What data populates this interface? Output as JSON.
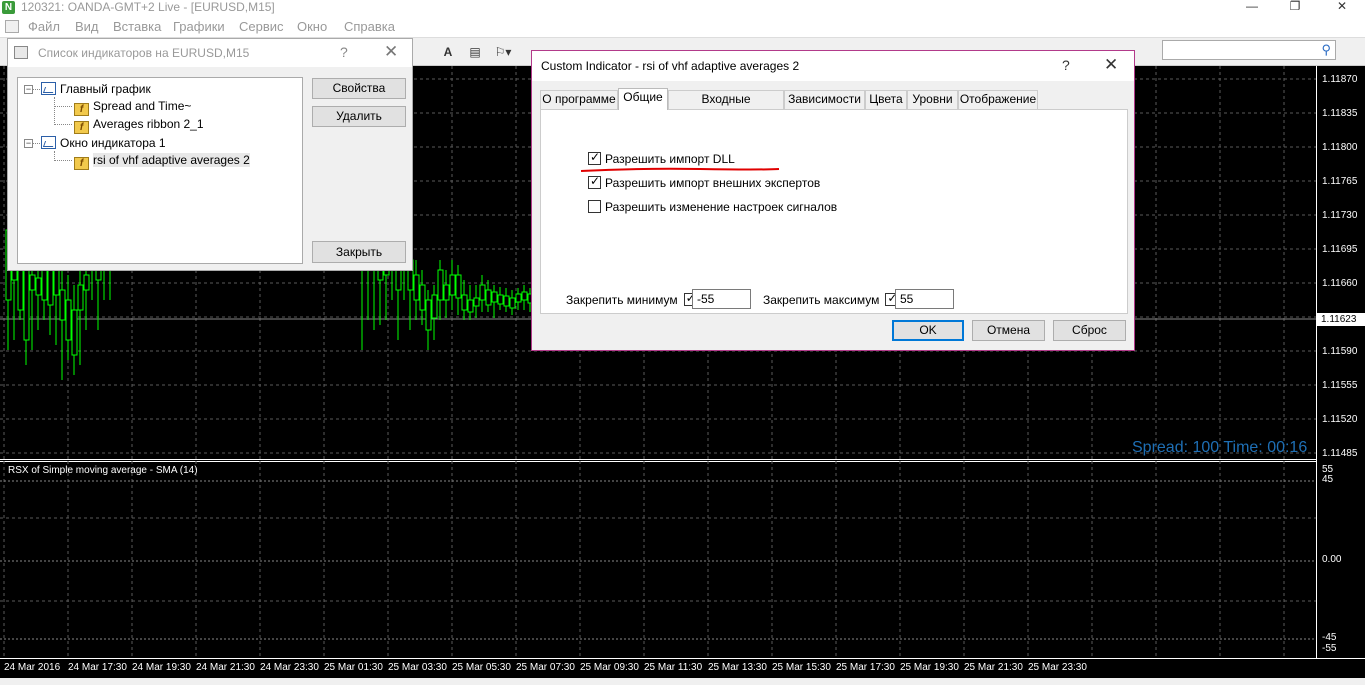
{
  "window": {
    "title": "120321: OANDA-GMT+2 Live - [EURUSD,M15]",
    "logo": "N",
    "controls": [
      "—",
      "❐",
      "✕"
    ]
  },
  "menu": [
    "Файл",
    "Вид",
    "Вставка",
    "Графики",
    "Сервис",
    "Окно",
    "Справка"
  ],
  "toolbar": {
    "icons": [
      "list-icon",
      "text-icon",
      "text-label-icon",
      "objects-icon",
      "search-icon"
    ]
  },
  "price_scale": [
    "1.11870",
    "1.11835",
    "1.11800",
    "1.11765",
    "1.11730",
    "1.11695",
    "1.11660",
    "1.11623",
    "1.11590",
    "1.11555",
    "1.11520",
    "1.11485"
  ],
  "current_price": "1.11623",
  "spread_label": "Spread: 100 Time: 00:16",
  "sub_window": {
    "title": "RSX of Simple moving average - SMA (14)",
    "levels": [
      "55",
      "45",
      "0.00",
      "-45",
      "-55"
    ]
  },
  "time_axis": [
    "24 Mar 2016",
    "24 Mar 17:30",
    "24 Mar 19:30",
    "24 Mar 21:30",
    "24 Mar 23:30",
    "25 Mar 01:30",
    "25 Mar 03:30",
    "25 Mar 05:30",
    "25 Mar 07:30",
    "25 Mar 09:30",
    "25 Mar 11:30",
    "25 Mar 13:30",
    "25 Mar 15:30",
    "25 Mar 17:30",
    "25 Mar 19:30",
    "25 Mar 21:30",
    "25 Mar 23:30"
  ],
  "indicators_dialog": {
    "title": "Список индикаторов на EURUSD,M15",
    "help": "?",
    "close": "✕",
    "tree": {
      "main_chart": "Главный график",
      "main_items": [
        "Spread and Time~",
        "Averages ribbon 2_1"
      ],
      "indicator_window": "Окно индикатора 1",
      "window_items": [
        "rsi of vhf adaptive averages 2"
      ]
    },
    "buttons": {
      "properties": "Свойства",
      "delete": "Удалить",
      "close": "Закрыть"
    }
  },
  "custom_dialog": {
    "title": "Custom Indicator - rsi of vhf adaptive averages 2",
    "help": "?",
    "close": "✕",
    "tabs": [
      "О программе",
      "Общие",
      "Входные параметры",
      "Зависимости",
      "Цвета",
      "Уровни",
      "Отображение"
    ],
    "active_tab": "Общие",
    "checkboxes": [
      {
        "label": "Разрешить импорт DLL",
        "checked": true
      },
      {
        "label": "Разрешить импорт внешних экспертов",
        "checked": true
      },
      {
        "label": "Разрешить изменение настроек сигналов",
        "checked": false
      }
    ],
    "fix_min": {
      "label": "Закрепить минимум",
      "checked": true,
      "value": "-55"
    },
    "fix_max": {
      "label": "Закрепить максимум",
      "checked": true,
      "value": "55"
    },
    "buttons": {
      "ok": "OK",
      "cancel": "Отмена",
      "reset": "Сброс"
    }
  },
  "colors": {
    "candle": "#00ff00",
    "grid": "#5a5a5a",
    "annotation": "#e00000",
    "spread_text": "#1e6fb5"
  }
}
